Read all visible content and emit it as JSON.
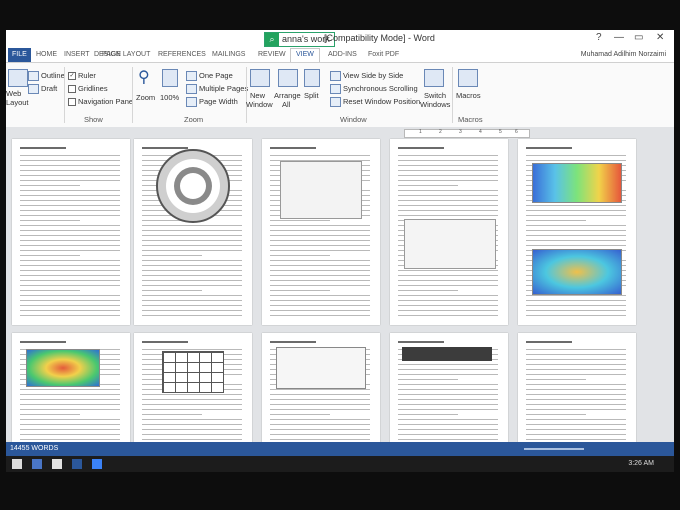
{
  "window": {
    "title": "[Compatibility Mode] - Word",
    "search_text": "anna's work",
    "user_name": "Muhamad Adilhim Norzaimi",
    "help": "?",
    "minimize": "—",
    "restore": "▭",
    "close": "✕"
  },
  "tabs": [
    "FILE",
    "HOME",
    "INSERT",
    "DESIGN",
    "PAGE LAYOUT",
    "REFERENCES",
    "MAILINGS",
    "REVIEW",
    "VIEW",
    "ADD-INS",
    "Foxit PDF"
  ],
  "active_tab": "VIEW",
  "ribbon": {
    "views": {
      "read_mode": "Web",
      "layout": "Layout",
      "outline": "Outline",
      "draft": "Draft"
    },
    "show": {
      "ruler": "Ruler",
      "gridlines": "Gridlines",
      "nav_pane": "Navigation Pane",
      "label": "Show"
    },
    "zoom": {
      "zoom": "Zoom",
      "percent": "100%",
      "one_page": "One Page",
      "multiple": "Multiple Pages",
      "page_width": "Page Width",
      "label": "Zoom"
    },
    "window": {
      "new": "New",
      "new2": "Window",
      "arrange": "Arrange",
      "arrange2": "All",
      "split": "Split",
      "side_by_side": "View Side by Side",
      "sync": "Synchronous Scrolling",
      "reset": "Reset Window Position",
      "switch": "Switch",
      "switch2": "Windows",
      "label": "Window"
    },
    "macros": {
      "macros": "Macros",
      "label": "Macros"
    }
  },
  "ruler_numbers": [
    "1",
    "2",
    "3",
    "4",
    "5",
    "6"
  ],
  "status": {
    "words": "14455 WORDS"
  },
  "taskbar": {
    "time": "3:26 AM"
  },
  "colors": {
    "word_blue": "#2b579a",
    "search_green": "#23a35e"
  }
}
